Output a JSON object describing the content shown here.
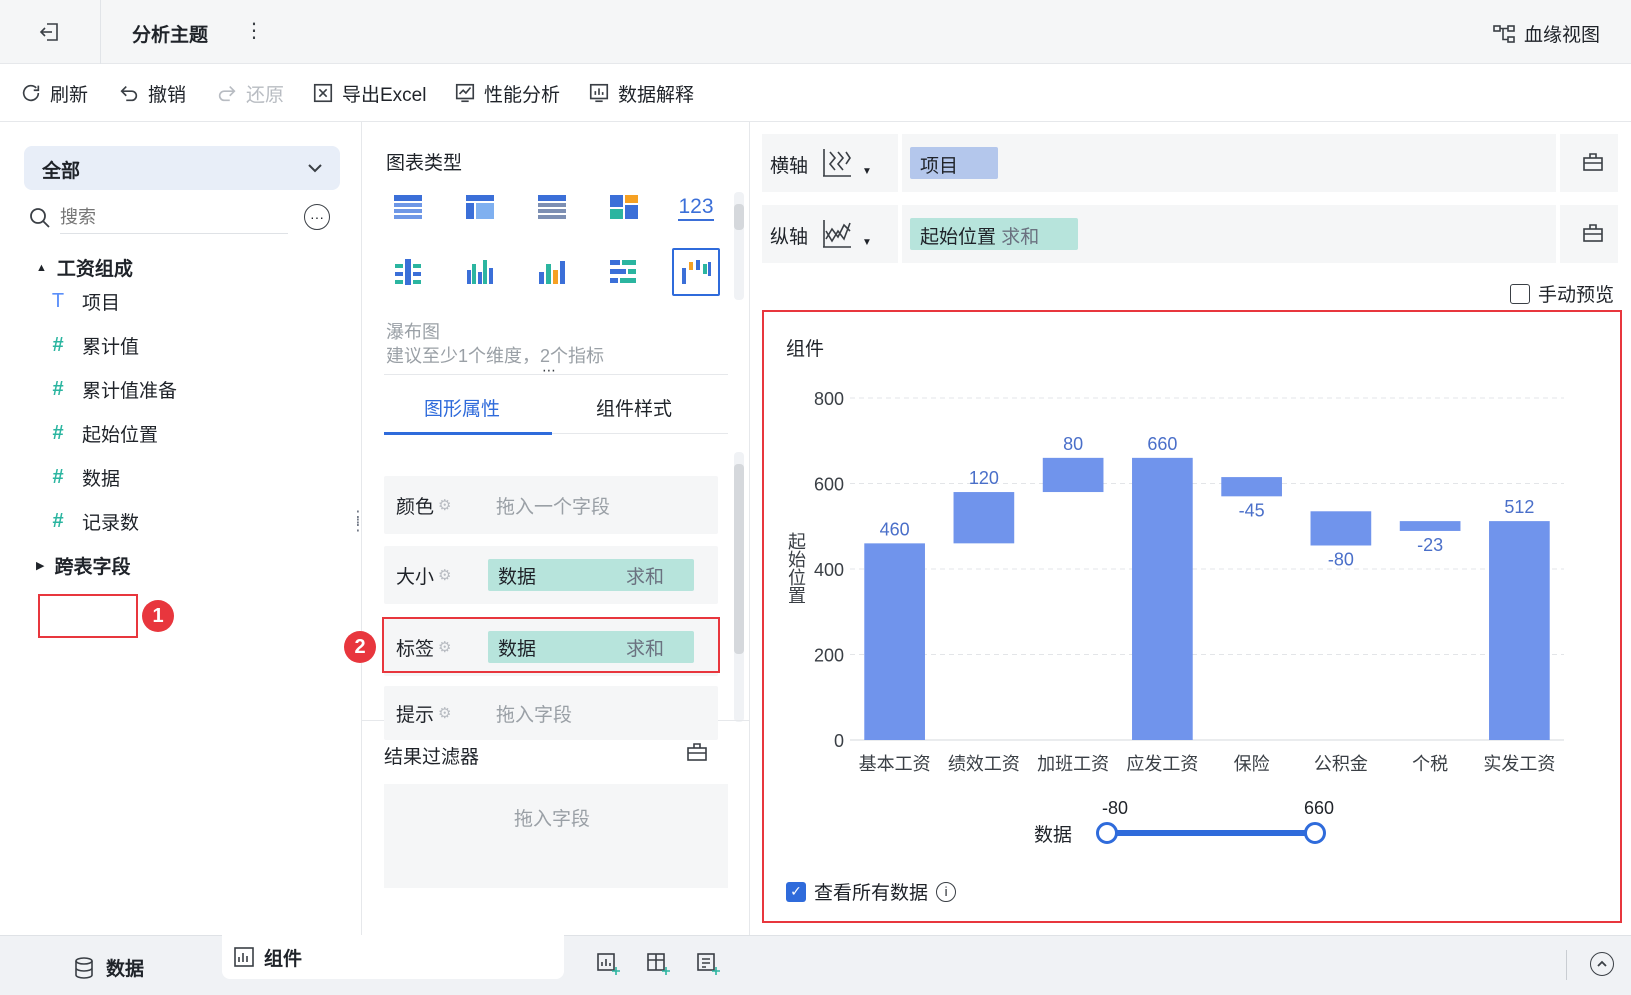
{
  "header": {
    "title": "分析主题",
    "lineage_label": "血缘视图"
  },
  "toolbar": {
    "refresh": "刷新",
    "undo": "撤销",
    "redo": "还原",
    "export": "导出Excel",
    "perf": "性能分析",
    "explain": "数据解释"
  },
  "left": {
    "scope": "全部",
    "search_placeholder": "搜索",
    "group1": "工资组成",
    "fields": [
      "项目",
      "累计值",
      "累计值准备",
      "起始位置",
      "数据",
      "记录数"
    ],
    "group2": "跨表字段",
    "badge1": "1"
  },
  "middle": {
    "chart_type_title": "图表类型",
    "number_icon": "123",
    "desc_name": "瀑布图",
    "desc_hint": "建议至少1个维度，2个指标",
    "tab_graph": "图形属性",
    "tab_style": "组件样式",
    "color_label": "颜色",
    "color_placeholder": "拖入一个字段",
    "size_label": "大小",
    "size_field": "数据",
    "size_agg": "求和",
    "label_label": "标签",
    "label_field": "数据",
    "label_agg": "求和",
    "tip_label": "提示",
    "tip_placeholder": "拖入字段",
    "badge2": "2",
    "filter_title": "结果过滤器",
    "filter_placeholder": "拖入字段"
  },
  "right": {
    "x_axis_label": "横轴",
    "x_axis_field": "项目",
    "y_axis_label": "纵轴",
    "y_axis_field": "起始位置",
    "y_axis_agg": "求和",
    "manual_preview": "手动预览",
    "component_title": "组件",
    "legend_label": "数据",
    "legend_min": "-80",
    "legend_max": "660",
    "view_all": "查看所有数据"
  },
  "chart_data": {
    "type": "bar",
    "subtype": "waterfall",
    "ylabel": "起始位置",
    "ylim": [
      0,
      800
    ],
    "yticks": [
      0,
      200,
      400,
      600,
      800
    ],
    "categories": [
      "基本工资",
      "绩效工资",
      "加班工资",
      "应发工资",
      "保险",
      "公积金",
      "个税",
      "实发工资"
    ],
    "base": [
      0,
      460,
      580,
      0,
      615,
      535,
      512,
      0
    ],
    "values": [
      460,
      120,
      80,
      660,
      -45,
      -80,
      -23,
      512
    ],
    "labels": [
      "460",
      "120",
      "80",
      "660",
      "-45",
      "-80",
      "-23",
      "512"
    ],
    "bar_color": "#7094ec",
    "grid": true
  },
  "bottom": {
    "tab_data": "数据",
    "tab_component": "组件"
  },
  "colors": {
    "accent": "#2f6bdb",
    "highlight": "#e8363d",
    "pill_teal": "#b7e4dc",
    "pill_blue": "#b4c7ec"
  }
}
